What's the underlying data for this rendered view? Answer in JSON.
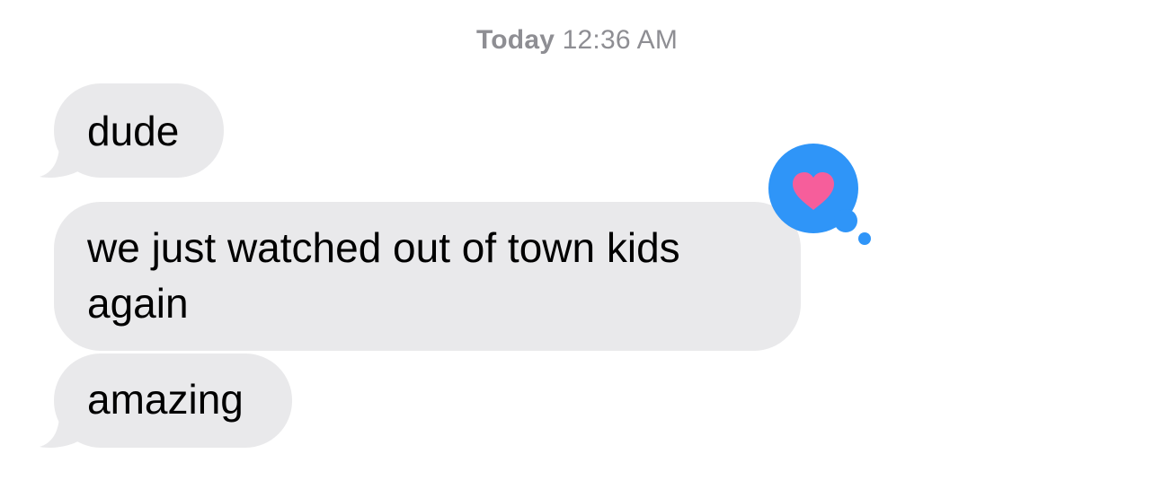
{
  "conversation": {
    "timestamp": {
      "day": "Today",
      "time": "12:36 AM"
    },
    "messages": [
      {
        "text": "dude",
        "direction": "incoming"
      },
      {
        "text": "we just watched out of town kids\nagain",
        "direction": "incoming",
        "tapback": "heart"
      },
      {
        "text": "amazing",
        "direction": "incoming"
      }
    ]
  },
  "colors": {
    "incoming_bubble": "#e9e9eb",
    "timestamp_text": "#8e8e93",
    "tapback_background": "#2f95f8",
    "heart": "#f65e9b"
  },
  "icons": {
    "tapback": "heart-icon"
  }
}
